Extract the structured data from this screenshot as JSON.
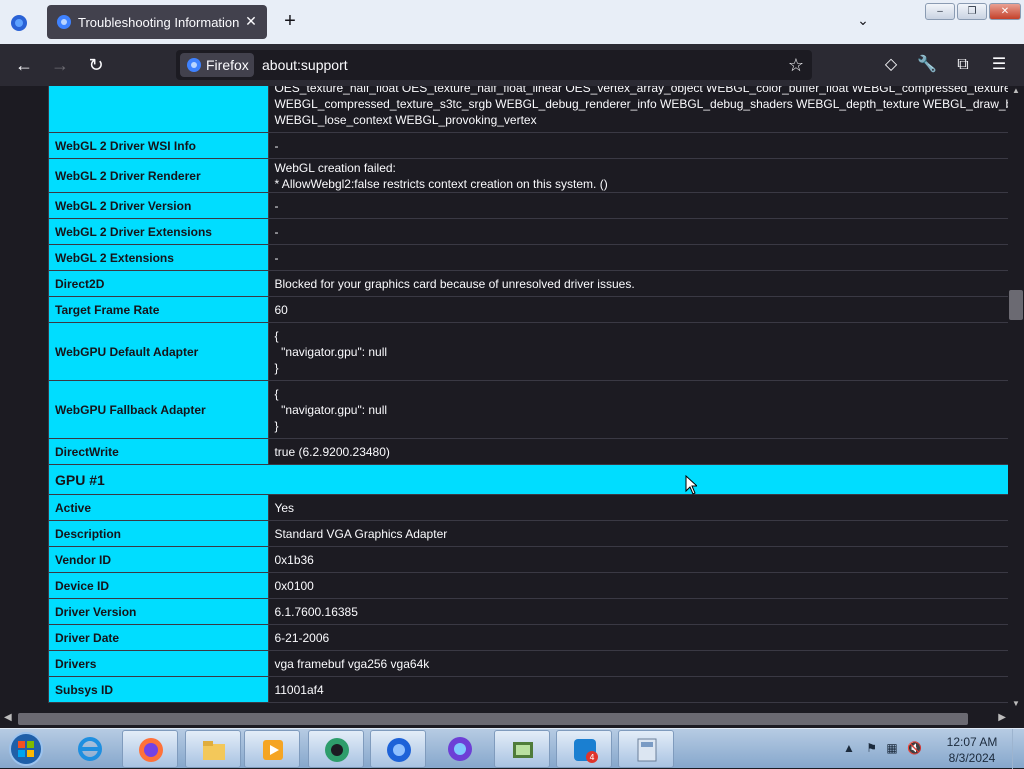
{
  "browser": {
    "tab_title": "Troubleshooting Information",
    "identity_label": "Firefox",
    "url": "about:support"
  },
  "rows_before": [
    {
      "key": "",
      "value": "OES_texture_half_float OES_texture_half_float_linear OES_vertex_array_object WEBGL_color_buffer_float WEBGL_compressed_texture_s3tc\nWEBGL_compressed_texture_s3tc_srgb WEBGL_debug_renderer_info WEBGL_debug_shaders WEBGL_depth_texture WEBGL_draw_buffers\nWEBGL_lose_context WEBGL_provoking_vertex"
    },
    {
      "key": "WebGL 2 Driver WSI Info",
      "value": "-"
    },
    {
      "key": "WebGL 2 Driver Renderer",
      "value": "WebGL creation failed:\n* AllowWebgl2:false restricts context creation on this system. ()"
    },
    {
      "key": "WebGL 2 Driver Version",
      "value": "-"
    },
    {
      "key": "WebGL 2 Driver Extensions",
      "value": "-"
    },
    {
      "key": "WebGL 2 Extensions",
      "value": "-"
    },
    {
      "key": "Direct2D",
      "value": "Blocked for your graphics card because of unresolved driver issues."
    },
    {
      "key": "Target Frame Rate",
      "value": "60"
    },
    {
      "key": "WebGPU Default Adapter",
      "value": "{\n  \"navigator.gpu\": null\n}"
    },
    {
      "key": "WebGPU Fallback Adapter",
      "value": "{\n  \"navigator.gpu\": null\n}"
    },
    {
      "key": "DirectWrite",
      "value": "true (6.2.9200.23480)"
    }
  ],
  "section_title": "GPU #1",
  "rows_after": [
    {
      "key": "Active",
      "value": "Yes"
    },
    {
      "key": "Description",
      "value": "Standard VGA Graphics Adapter"
    },
    {
      "key": "Vendor ID",
      "value": "0x1b36"
    },
    {
      "key": "Device ID",
      "value": "0x0100"
    },
    {
      "key": "Driver Version",
      "value": "6.1.7600.16385"
    },
    {
      "key": "Driver Date",
      "value": "6-21-2006"
    },
    {
      "key": "Drivers",
      "value": "vga framebuf vga256 vga64k"
    },
    {
      "key": "Subsys ID",
      "value": "11001af4"
    }
  ],
  "taskbar": {
    "notification_badge": "4",
    "time": "12:07 AM",
    "date": "8/3/2024"
  },
  "colors": {
    "accent": "#00ddff",
    "background": "#1c1b22",
    "toolbar": "#2b2a33"
  }
}
